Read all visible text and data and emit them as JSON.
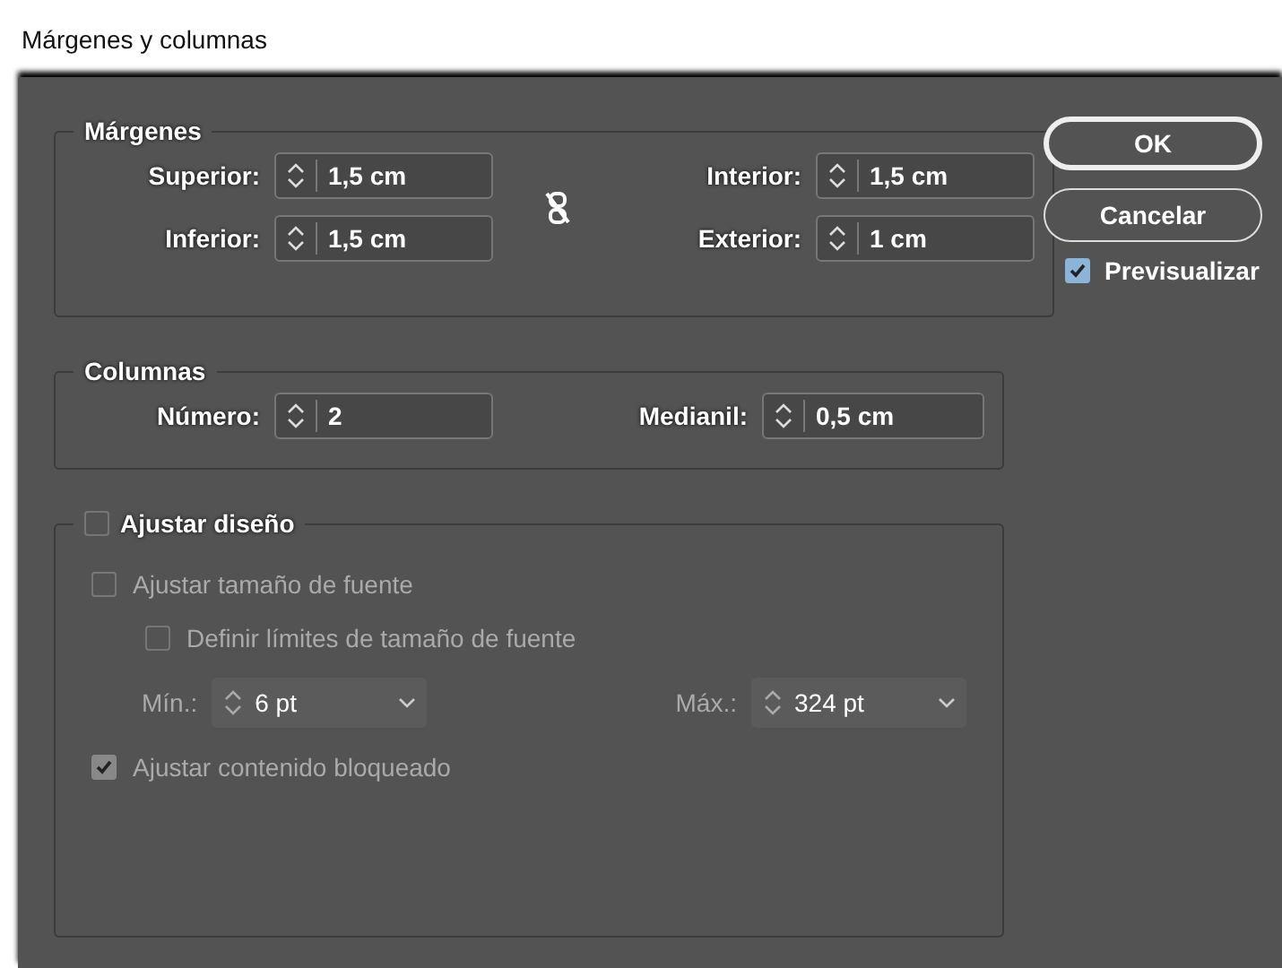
{
  "window": {
    "title": "Márgenes y columnas"
  },
  "margins": {
    "title": "Márgenes",
    "fields": [
      {
        "label": "Superior:",
        "value": "1,5 cm"
      },
      {
        "label": "Interior:",
        "value": "1,5 cm"
      },
      {
        "label": "Inferior:",
        "value": "1,5 cm"
      },
      {
        "label": "Exterior:",
        "value": "1 cm"
      }
    ]
  },
  "columns": {
    "title": "Columnas",
    "fields": [
      {
        "label": "Número:",
        "value": "2"
      },
      {
        "label": "Medianil:",
        "value": "0,5 cm"
      }
    ]
  },
  "adjust": {
    "label": "Ajustar diseño",
    "checked": false,
    "items": [
      {
        "kind": "checkbox",
        "label": "Ajustar tamaño de fuente",
        "checked": false,
        "children": [
          {
            "kind": "checkbox",
            "label": "Definir límites de tamaño de fuente",
            "checked": false
          }
        ]
      },
      {
        "kind": "range",
        "fields": [
          {
            "label": "Mín.:",
            "value": "6 pt"
          },
          {
            "label": "Máx.:",
            "value": "324 pt"
          }
        ]
      },
      {
        "kind": "checkbox",
        "label": "Ajustar contenido bloqueado",
        "checked": true
      }
    ]
  },
  "buttons": [
    {
      "label": "OK",
      "default": true
    },
    {
      "label": "Cancelar",
      "default": false
    }
  ],
  "preview": {
    "label": "Previsualizar",
    "checked": true
  }
}
